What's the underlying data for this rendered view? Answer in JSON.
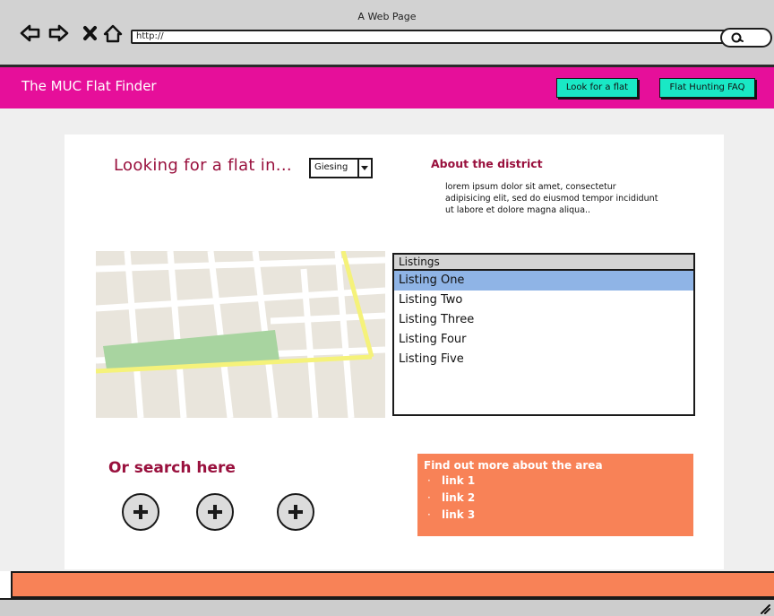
{
  "browser": {
    "window_title": "A Web Page",
    "url_value": "http://"
  },
  "header": {
    "site_title": "The MUC Flat Finder",
    "nav_buttons": [
      "Look for a flat",
      "Flat Hunting FAQ"
    ]
  },
  "search_section": {
    "heading": "Looking for a flat in...",
    "district_selected": "Giesing"
  },
  "about": {
    "title": "About the district",
    "text": "lorem ipsum dolor sit amet, consectetur adipisicing elit, sed do eiusmod tempor incididunt ut labore et dolore magna aliqua.."
  },
  "listings": {
    "header": "Listings",
    "items": [
      "Listing One",
      "Listing Two",
      "Listing Three",
      "Listing Four",
      "Listing Five"
    ],
    "selected_index": 0
  },
  "alt_search": {
    "heading": "Or search here"
  },
  "area_box": {
    "title": "Find out more about the area",
    "links": [
      "link 1",
      "link 2",
      "link 3"
    ]
  },
  "icons": {
    "back": "back-arrow-icon",
    "forward": "forward-arrow-icon",
    "stop": "close-icon",
    "home": "home-icon",
    "search": "search-icon",
    "add": "plus-icon"
  },
  "colors": {
    "brand": "#e60f9a",
    "accent_button": "#19e8c5",
    "heading": "#99103d",
    "selection": "#8fb4e6",
    "area_box": "#f88257"
  }
}
